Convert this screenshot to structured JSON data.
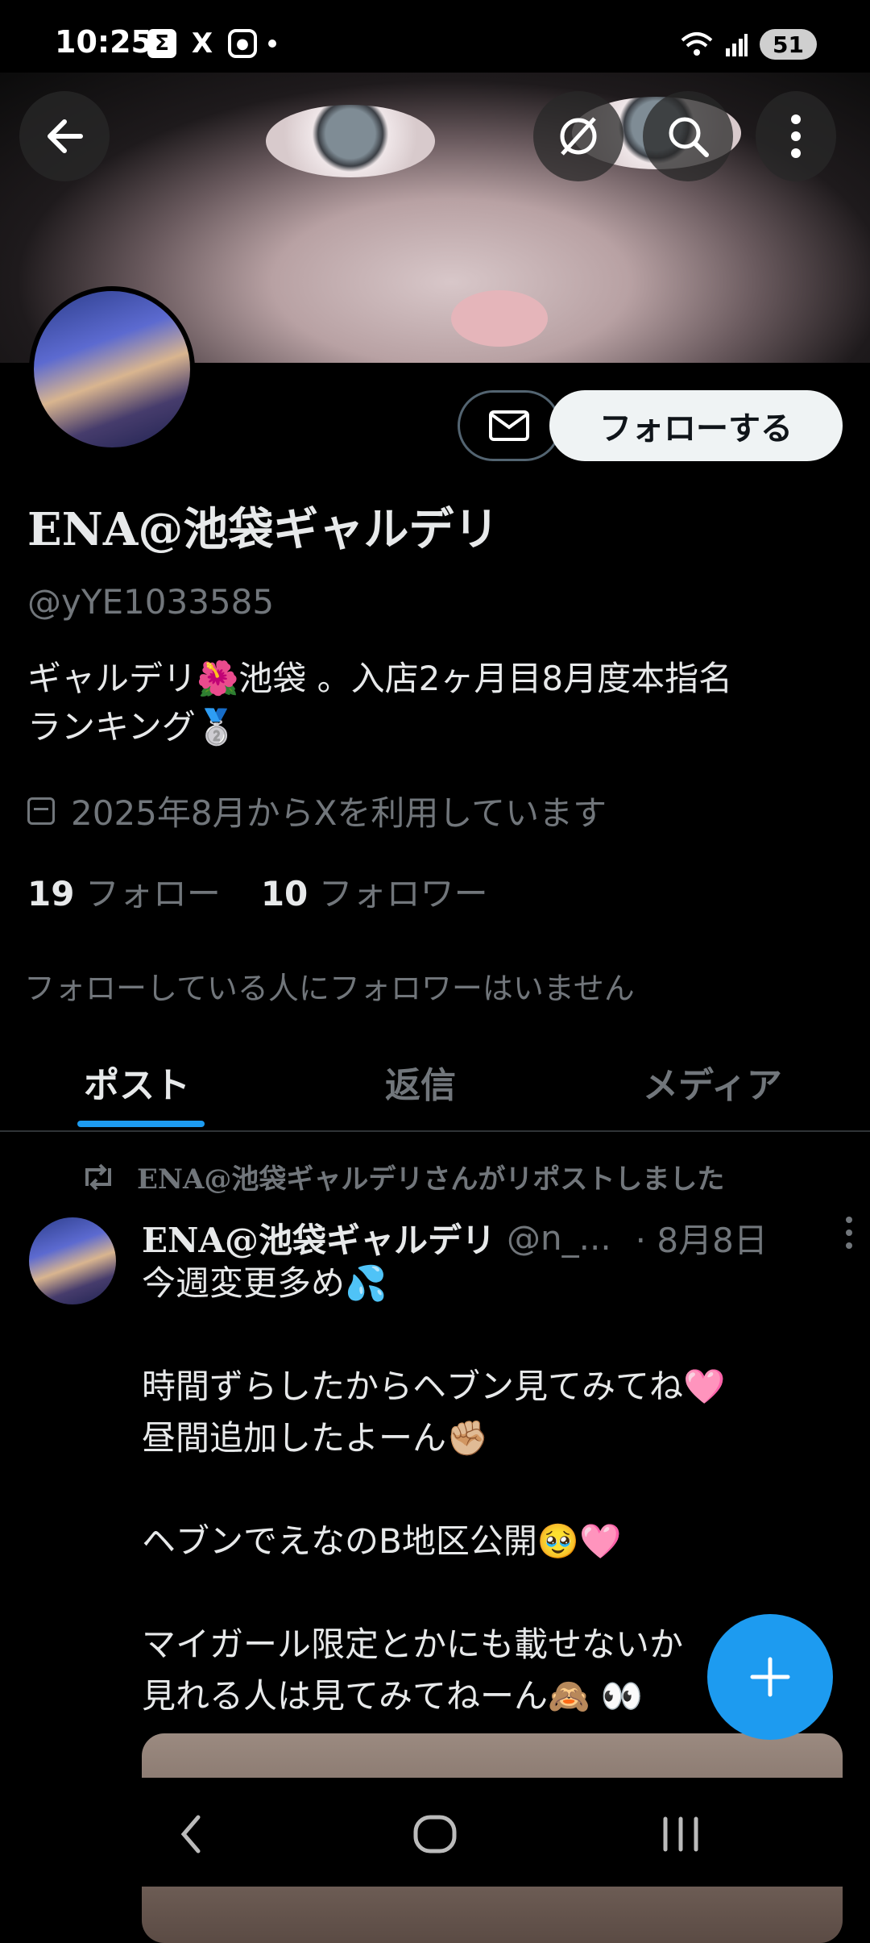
{
  "status_bar": {
    "time": "10:25",
    "app_icons": [
      "Σ",
      "X",
      "instagram-icon"
    ],
    "battery": "51"
  },
  "profile": {
    "display_name": "ENA@池袋ギャルデリ",
    "handle": "@yYE1033585",
    "bio_line1": "ギャルデリ🌺池袋 。入店2ヶ月目8月度本指名",
    "bio_line2": "ランキング🥈",
    "joined": "2025年8月からXを利用しています",
    "following_count": "19",
    "following_label": "フォロー",
    "followers_count": "10",
    "followers_label": "フォロワー",
    "mutual_note": "フォローしている人にフォロワーはいません",
    "follow_button": "フォローする"
  },
  "tabs": [
    {
      "label": "ポスト",
      "active": true
    },
    {
      "label": "返信",
      "active": false
    },
    {
      "label": "メディア",
      "active": false
    }
  ],
  "post": {
    "repost_label": "ENA@池袋ギャルデリさんがリポストしました",
    "author_name": "ENA@池袋ギャルデリ",
    "author_handle": "@n_...",
    "date": "· 8月8日",
    "lines": [
      "今週変更多め💦",
      "",
      "時間ずらしたからヘブン見てみてね🩷",
      "昼間追加したよーん✊🏼",
      "",
      "ヘブンでえなのB地区公開🥹🩷",
      "",
      "マイガール限定とかにも載せないか",
      "見れる人は見てみてねーん🙈 👀"
    ]
  },
  "colors": {
    "accent": "#1d9bf0",
    "secondary_text": "#71767b",
    "primary_text": "#e7e9ea"
  }
}
